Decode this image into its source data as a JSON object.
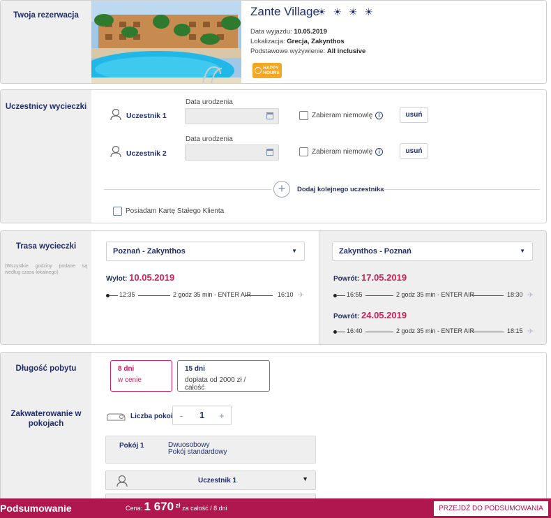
{
  "reservation": {
    "section_title": "Twoja rezerwacja",
    "hotel_name": "Zante Village",
    "stars": "☀ ☀ ☀ ☀",
    "departure_label": "Data wyjazdu:",
    "departure_value": "10.05.2019",
    "location_label": "Lokalizacja:",
    "location_value": "Grecja, Zakynthos",
    "board_label": "Podstawowe wyżywienie:",
    "board_value": "All inclusive",
    "badge_line1": "HAPPY",
    "badge_line2": "HOURS"
  },
  "participants": {
    "section_title": "Uczestnicy wycieczki",
    "dob_label": "Data urodzenia",
    "infant_label": "Zabieram niemowlę",
    "remove_label": "usuń",
    "items": [
      {
        "name": "Uczestnik 1"
      },
      {
        "name": "Uczestnik 2"
      }
    ],
    "add_label": "Dodaj kolejnego uczestnika",
    "loyalty_label": "Posiadam Kartę Stałego Klienta"
  },
  "route": {
    "section_title": "Trasa wycieczki",
    "note": "(Wszystkie godziny podane są według czasu lokalnego)",
    "outbound": {
      "route": "Poznań - Zakynthos",
      "date_label": "Wylot:",
      "date": "10.05.2019",
      "dep": "12:35",
      "info": "2 godz 35 min - ENTER AIR",
      "arr": "16:10"
    },
    "return": {
      "route": "Zakynthos - Poznań",
      "options": [
        {
          "date_label": "Powrót:",
          "date": "17.05.2019",
          "dep": "16:55",
          "info": "2 godz 35 min - ENTER AIR",
          "arr": "18:30"
        },
        {
          "date_label": "Powrót:",
          "date": "24.05.2019",
          "dep": "16:40",
          "info": "2 godz 35 min - ENTER AIR",
          "arr": "18:15"
        }
      ]
    }
  },
  "stay": {
    "length_title": "Długość pobytu",
    "opt1_days": "8 dni",
    "opt1_sub": "w cenie",
    "opt2_days": "15 dni",
    "opt2_sub": "dopłata od 2000 zł / całość",
    "accommodation_title": "Zakwaterowanie w pokojach",
    "rooms_label": "Liczba pokoi",
    "rooms_minus": "-",
    "rooms_value": "1",
    "rooms_plus": "+",
    "room_label": "Pokój 1",
    "room_type": "Dwuosobowy",
    "room_std": "Pokój standardowy",
    "assign1": "Uczestnik 1"
  },
  "summary": {
    "title": "Podsumowanie",
    "price_label": "Cena:",
    "price_value": "1 670",
    "currency": "zł",
    "price_suffix": "za całość / 8 dni",
    "cta": "PRZEJDŹ DO PODSUMOWANIA"
  },
  "colors": {
    "navy": "#1f2d6b",
    "accent": "#d0205c",
    "bar": "#b0174e",
    "badge": "#f5a623"
  }
}
